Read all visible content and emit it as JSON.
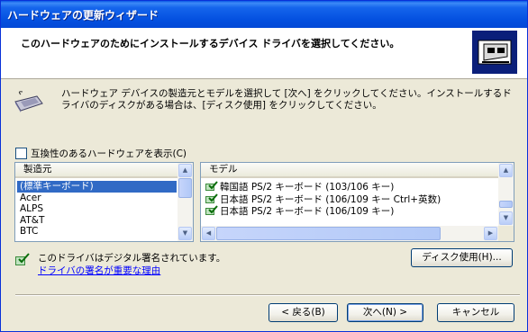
{
  "window": {
    "title": "ハードウェアの更新ウィザード"
  },
  "header": {
    "heading": "このハードウェアのためにインストールするデバイス ドライバを選択してください。"
  },
  "description": "ハードウェア デバイスの製造元とモデルを選択して [次へ] をクリックしてください。インストールするドライバのディスクがある場合は、[ディスク使用] をクリックしてください。",
  "compat_checkbox": {
    "label": "互換性のあるハードウェアを表示(C)",
    "checked": false
  },
  "manufacturer_list": {
    "header": "製造元",
    "items": [
      "(標準キーボード)",
      "Acer",
      "ALPS",
      "AT&T",
      "BTC"
    ],
    "selected_index": 0
  },
  "model_list": {
    "header": "モデル",
    "items": [
      "韓国語 PS/2 キーボード (103/106 キー)",
      "日本語 PS/2 キーボード (106/109 キー Ctrl+英数)",
      "日本語 PS/2 キーボード (106/109 キー)"
    ]
  },
  "driver_sign": {
    "status": "このドライバはデジタル署名されています。",
    "link": "ドライバの署名が重要な理由"
  },
  "buttons": {
    "have_disk": "ディスク使用(H)...",
    "back": "< 戻る(B)",
    "next": "次へ(N) >",
    "cancel": "キャンセル"
  },
  "colors": {
    "titlebar": "#0450e0",
    "selection": "#316ac5",
    "link": "#0000ff"
  }
}
